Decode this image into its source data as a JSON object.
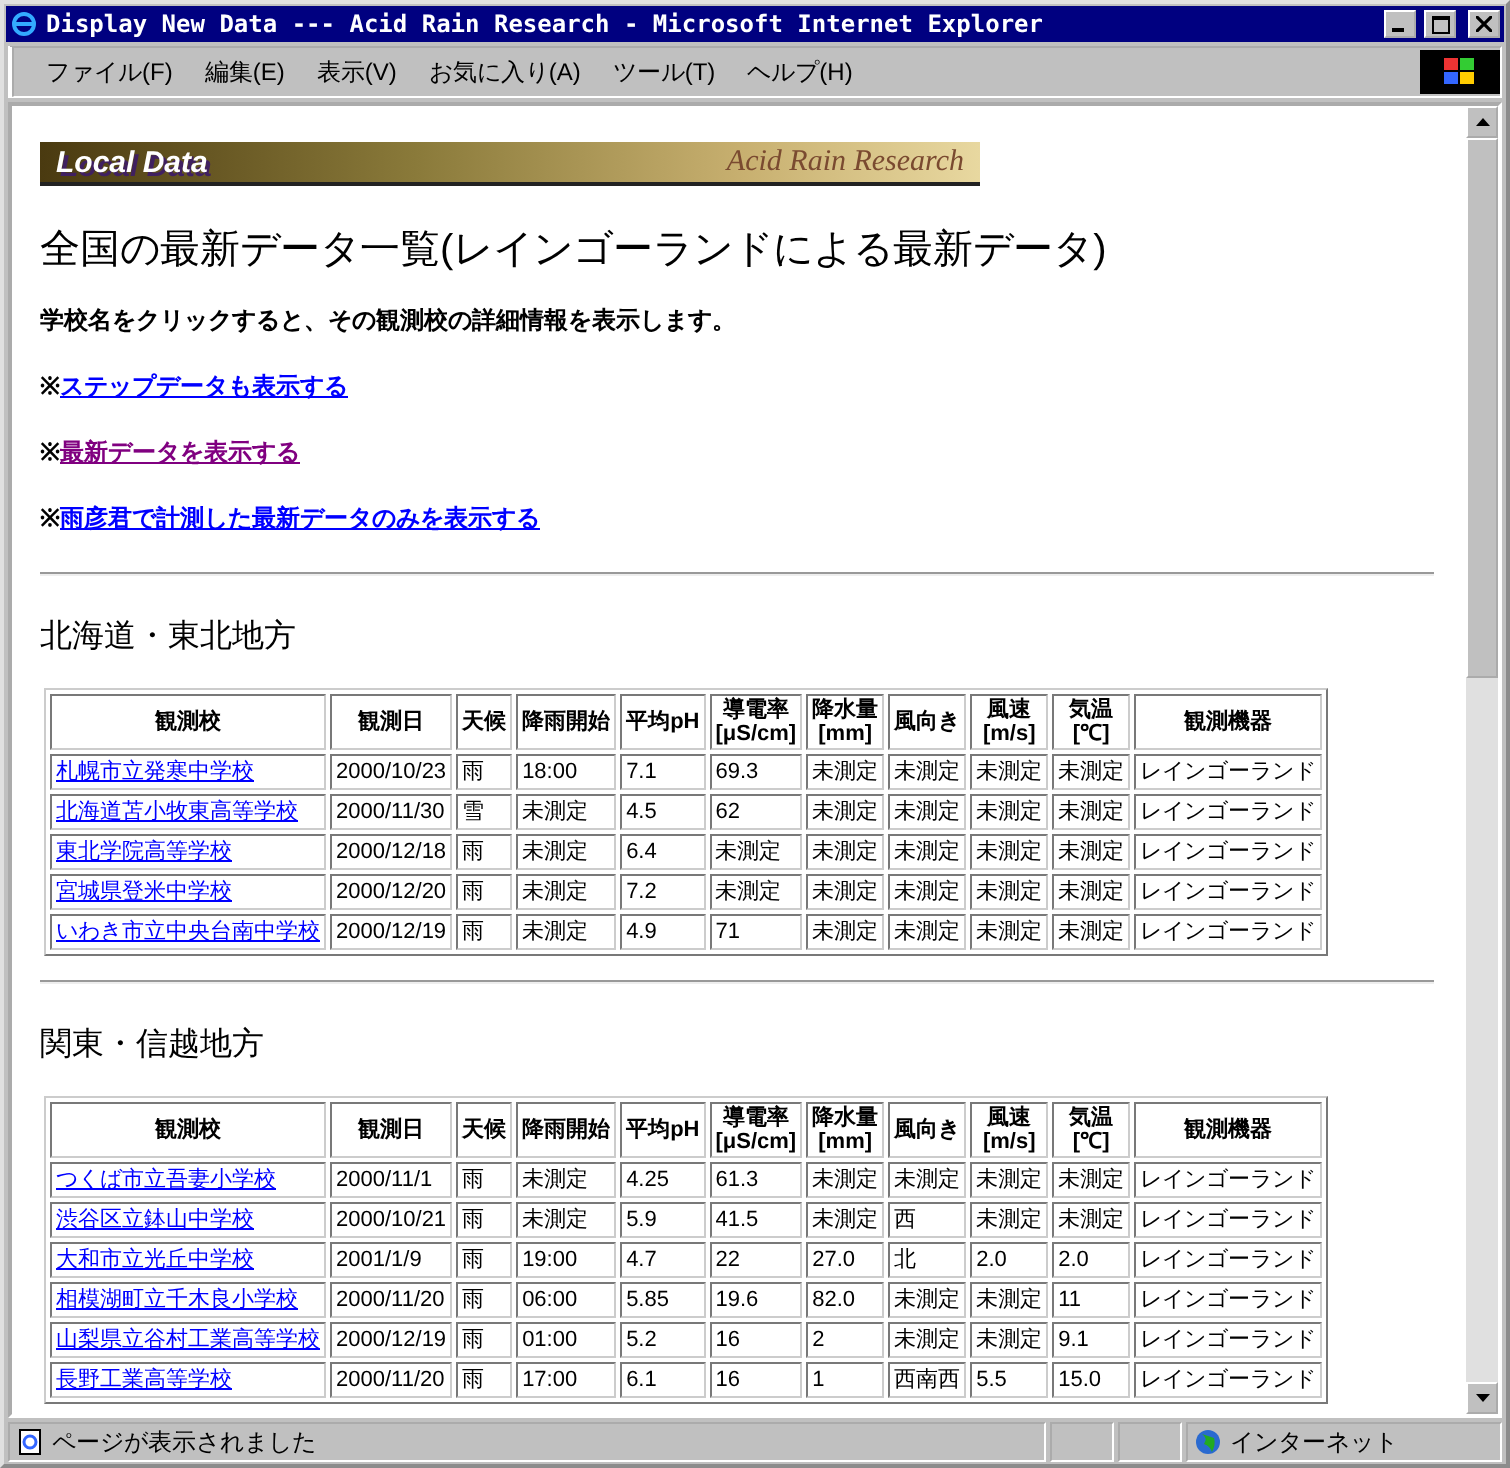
{
  "window": {
    "title": "Display New Data --- Acid Rain Research - Microsoft Internet Explorer"
  },
  "menu": [
    "ファイル(F)",
    "編集(E)",
    "表示(V)",
    "お気に入り(A)",
    "ツール(T)",
    "ヘルプ(H)"
  ],
  "banner": {
    "left": "Local Data",
    "right": "Acid Rain Research"
  },
  "heading": "全国の最新データ一覧(レインゴーランドによる最新データ)",
  "intro": "学校名をクリックすると、その観測校の詳細情報を表示します。",
  "links": [
    {
      "mark": "※",
      "label": "ステップデータも表示する",
      "visited": false
    },
    {
      "mark": "※",
      "label": "最新データを表示する",
      "visited": true
    },
    {
      "mark": "※",
      "label": "雨彦君で計測した最新データのみを表示する",
      "visited": false
    }
  ],
  "sections": [
    {
      "title": "北海道・東北地方",
      "columns": [
        "観測校",
        "観測日",
        "天候",
        "降雨開始",
        "平均pH",
        "導電率\n[μS/cm]",
        "降水量\n[mm]",
        "風向き",
        "風速\n[m/s]",
        "気温\n[℃]",
        "観測機器"
      ],
      "rows": [
        [
          "札幌市立発寒中学校",
          "2000/10/23",
          "雨",
          "18:00",
          "7.1",
          "69.3",
          "未測定",
          "未測定",
          "未測定",
          "未測定",
          "レインゴーランド"
        ],
        [
          "北海道苫小牧東高等学校",
          "2000/11/30",
          "雪",
          "未測定",
          "4.5",
          "62",
          "未測定",
          "未測定",
          "未測定",
          "未測定",
          "レインゴーランド"
        ],
        [
          "東北学院高等学校",
          "2000/12/18",
          "雨",
          "未測定",
          "6.4",
          "未測定",
          "未測定",
          "未測定",
          "未測定",
          "未測定",
          "レインゴーランド"
        ],
        [
          "宮城県登米中学校",
          "2000/12/20",
          "雨",
          "未測定",
          "7.2",
          "未測定",
          "未測定",
          "未測定",
          "未測定",
          "未測定",
          "レインゴーランド"
        ],
        [
          "いわき市立中央台南中学校",
          "2000/12/19",
          "雨",
          "未測定",
          "4.9",
          "71",
          "未測定",
          "未測定",
          "未測定",
          "未測定",
          "レインゴーランド"
        ]
      ]
    },
    {
      "title": "関東・信越地方",
      "columns": [
        "観測校",
        "観測日",
        "天候",
        "降雨開始",
        "平均pH",
        "導電率\n[μS/cm]",
        "降水量\n[mm]",
        "風向き",
        "風速\n[m/s]",
        "気温\n[℃]",
        "観測機器"
      ],
      "rows": [
        [
          "つくば市立吾妻小学校",
          "2000/11/1",
          "雨",
          "未測定",
          "4.25",
          "61.3",
          "未測定",
          "未測定",
          "未測定",
          "未測定",
          "レインゴーランド"
        ],
        [
          "渋谷区立鉢山中学校",
          "2000/10/21",
          "雨",
          "未測定",
          "5.9",
          "41.5",
          "未測定",
          "西",
          "未測定",
          "未測定",
          "レインゴーランド"
        ],
        [
          "大和市立光丘中学校",
          "2001/1/9",
          "雨",
          "19:00",
          "4.7",
          "22",
          "27.0",
          "北",
          "2.0",
          "2.0",
          "レインゴーランド"
        ],
        [
          "相模湖町立千木良小学校",
          "2000/11/20",
          "雨",
          "06:00",
          "5.85",
          "19.6",
          "82.0",
          "未測定",
          "未測定",
          "11",
          "レインゴーランド"
        ],
        [
          "山梨県立谷村工業高等学校",
          "2000/12/19",
          "雨",
          "01:00",
          "5.2",
          "16",
          "2",
          "未測定",
          "未測定",
          "9.1",
          "レインゴーランド"
        ],
        [
          "長野工業高等学校",
          "2000/11/20",
          "雨",
          "17:00",
          "6.1",
          "16",
          "1",
          "西南西",
          "5.5",
          "15.0",
          "レインゴーランド"
        ]
      ]
    }
  ],
  "status_bar": {
    "message": "ページが表示されました",
    "zone": "インターネット"
  }
}
